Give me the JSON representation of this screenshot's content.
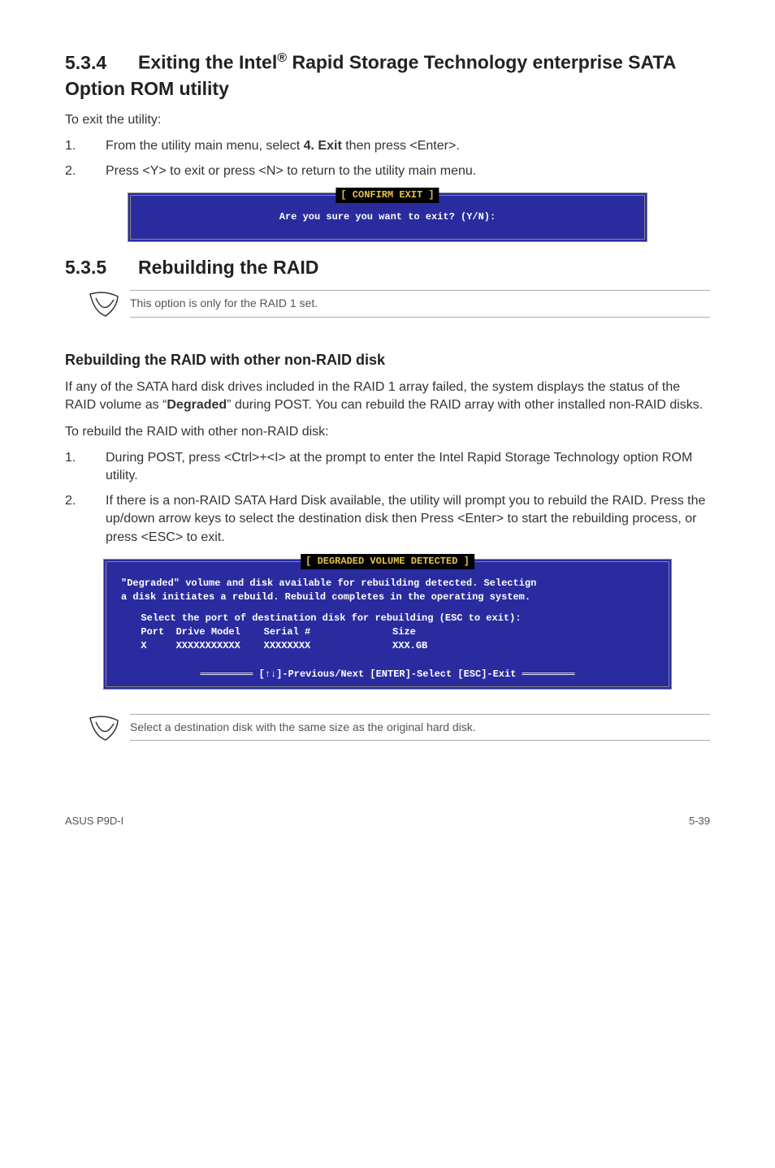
{
  "section534": {
    "number": "5.3.4",
    "title_part1": "Exiting the Intel",
    "title_reg": "®",
    "title_part2": " Rapid Storage Technology enterprise SATA Option ROM utility",
    "intro": "To exit the utility:",
    "step1_num": "1.",
    "step1_a": "From the utility main menu, select ",
    "step1_b": "4. Exit",
    "step1_c": " then press <Enter>.",
    "step2_num": "2.",
    "step2": "Press <Y> to exit or press <N> to return to the utility main menu.",
    "term_title": "[ CONFIRM EXIT ]",
    "term_body": "Are you sure you want to exit? (Y/N):"
  },
  "section535": {
    "number": "5.3.5",
    "title": "Rebuilding the RAID",
    "note1": "This option is only for the RAID 1 set.",
    "subheading": "Rebuilding the RAID with other non-RAID disk",
    "para1_a": "If any of the SATA hard disk drives included in the RAID 1 array failed, the system displays the status of the RAID volume as “",
    "para1_b": "Degraded",
    "para1_c": "” during POST. You can rebuild the RAID array with other installed non-RAID disks.",
    "para2": "To rebuild the RAID with other non-RAID disk:",
    "step1_num": "1.",
    "step1": "During POST, press <Ctrl>+<I> at the prompt to enter the Intel Rapid Storage Technology option ROM utility.",
    "step2_num": "2.",
    "step2": "If there is a non-RAID SATA Hard Disk available, the utility will prompt you to rebuild the RAID. Press the up/down arrow keys to select  the destination disk then Press <Enter>  to start the rebuilding process, or press <ESC> to exit.",
    "term_title": "[ DEGRADED VOLUME DETECTED ]",
    "term_line1": "\"Degraded\" volume and disk available for rebuilding detected. Selectign",
    "term_line2": "a disk initiates a rebuild. Rebuild completes in the operating system.",
    "term_block": "  Select the port of destination disk for rebuilding (ESC to exit):\n  Port  Drive Model    Serial #              Size\n  X     XXXXXXXXXXX    XXXXXXXX              XXX.GB",
    "term_footer": "[↑↓]-Previous/Next [ENTER]-Select [ESC]-Exit",
    "note2": "Select a destination disk with the same size as the original hard disk."
  },
  "footer": {
    "left": "ASUS P9D-I",
    "right": "5-39"
  }
}
